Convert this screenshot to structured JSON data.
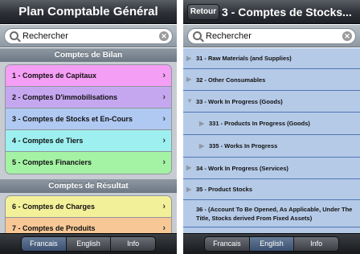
{
  "left": {
    "title": "Plan Comptable Général",
    "search_placeholder": "Rechercher",
    "sections": [
      {
        "header": "Comptes de Bilan",
        "rows": [
          {
            "label": "1 - Comptes de Capitaux",
            "color": "#f59ef5"
          },
          {
            "label": "2 - Comptes D'immobilisations",
            "color": "#c5a7f0"
          },
          {
            "label": "3 - Comptes de Stocks et En-Cours",
            "color": "#b0c9f2"
          },
          {
            "label": "4 - Comptes de Tiers",
            "color": "#9ef0f0"
          },
          {
            "label": "5 - Comptes Financiers",
            "color": "#a4f2a4"
          }
        ]
      },
      {
        "header": "Comptes de Résultat",
        "rows": [
          {
            "label": "6 - Comptes de Charges",
            "color": "#f3f09a"
          },
          {
            "label": "7 - Comptes de Produits",
            "color": "#f7c896"
          }
        ]
      }
    ],
    "tabs": [
      {
        "label": "Francais",
        "selected": true
      },
      {
        "label": "English",
        "selected": false
      },
      {
        "label": "Info",
        "selected": false
      }
    ]
  },
  "right": {
    "back_label": "Retour",
    "title": "3 - Comptes de Stocks...",
    "search_placeholder": "Rechercher",
    "items": [
      {
        "label": "31 - Raw Materials (and Supplies)",
        "level": 0,
        "expanded": false
      },
      {
        "label": "32 - Other Consumables",
        "level": 0,
        "expanded": false
      },
      {
        "label": "33 - Work In Progress (Goods)",
        "level": 0,
        "expanded": true
      },
      {
        "label": "331 - Products In Progress (Goods)",
        "level": 1,
        "expanded": false
      },
      {
        "label": "335 - Works In Progress",
        "level": 1,
        "expanded": false
      },
      {
        "label": "34 - Work In Progress (Services)",
        "level": 0,
        "expanded": false
      },
      {
        "label": "35 - Product Stocks",
        "level": 0,
        "expanded": false
      },
      {
        "label": "36 - (Account To Be Opened, As Applicable, Under The Title, Stocks derived From Fixed Assets)",
        "level": 0,
        "expanded": false,
        "leaf": true
      }
    ],
    "tabs": [
      {
        "label": "Francais",
        "selected": false
      },
      {
        "label": "English",
        "selected": true
      },
      {
        "label": "Info",
        "selected": false
      }
    ]
  }
}
